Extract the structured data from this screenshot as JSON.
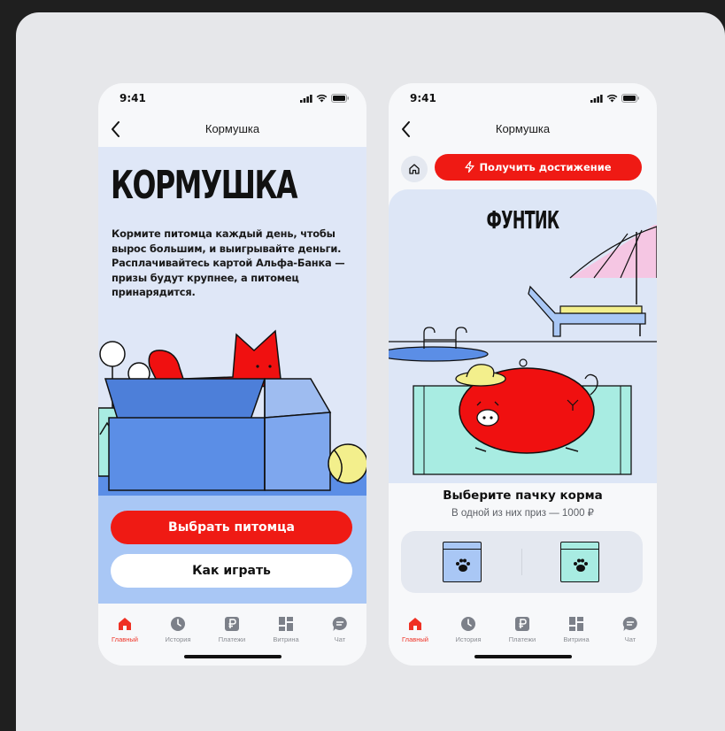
{
  "status": {
    "time": "9:41"
  },
  "left": {
    "nav_title": "Кормушка",
    "hero_title": "КОРМУШКА",
    "description": "Кормите питомца каждый день, чтобы вырос большим, и выигрывайте деньги. Расплачивайтесь картой Альфа-Банка — призы будут крупнее, а питомец принарядится.",
    "primary_button": "Выбрать питомца",
    "secondary_button": "Как играть"
  },
  "right": {
    "nav_title": "Кормушка",
    "achievement_button": "Получить достижение",
    "pet_name": "ФУНТИК",
    "choose_title": "Выберите пачку корма",
    "choose_subtitle": "В одной из них приз — 1000 ₽"
  },
  "tabs": [
    {
      "label": "Главный",
      "icon": "home-icon",
      "active": true
    },
    {
      "label": "История",
      "icon": "clock-icon",
      "active": false
    },
    {
      "label": "Платежи",
      "icon": "ruble-icon",
      "active": false
    },
    {
      "label": "Витрина",
      "icon": "grid-icon",
      "active": false
    },
    {
      "label": "Чат",
      "icon": "chat-icon",
      "active": false
    }
  ],
  "colors": {
    "accent_red": "#ef1a14",
    "hero_blue": "#dfe7f7",
    "box_blue": "#5b8ee6",
    "pet_red": "#f01010",
    "mint": "#a8ece2",
    "light_blue": "#a9c7f5"
  }
}
